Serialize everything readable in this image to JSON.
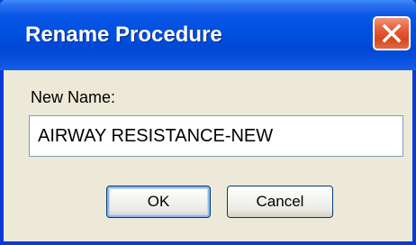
{
  "dialog": {
    "title": "Rename Procedure",
    "close_icon": "close-x-icon",
    "new_name_label": "New Name:",
    "new_name_value": "AIRWAY RESISTANCE-NEW",
    "ok_label": "OK",
    "cancel_label": "Cancel"
  },
  "colors": {
    "titlebar": "#0050e0",
    "window_border": "#0a3ad8",
    "dialog_background": "#ece9d8",
    "close_button": "#e5603c"
  }
}
